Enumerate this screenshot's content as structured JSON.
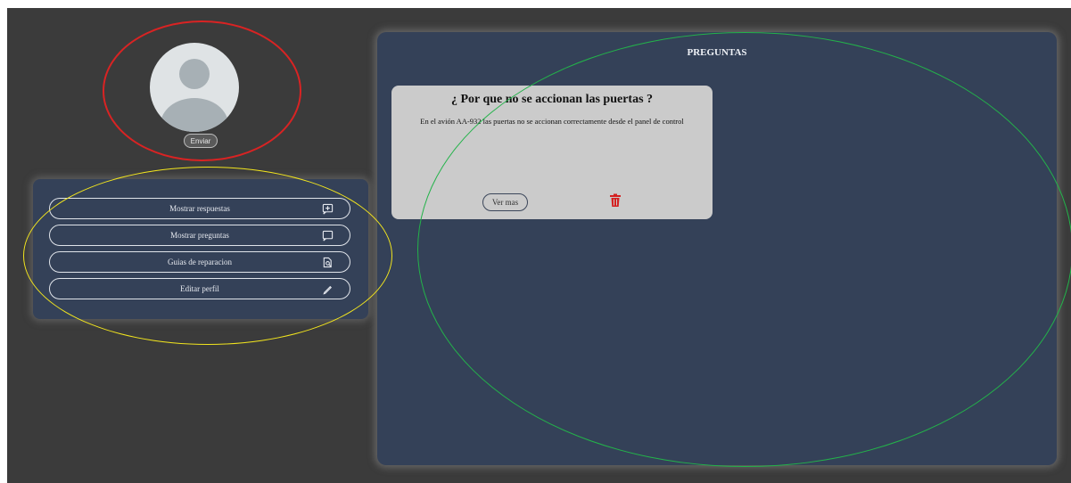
{
  "profile": {
    "avatar_icon": "user-avatar-icon",
    "send_label": "Enviar"
  },
  "menu": {
    "items": [
      {
        "label": "Mostrar respuestas",
        "icon": "add-comment-icon"
      },
      {
        "label": "Mostrar preguntas",
        "icon": "comment-icon"
      },
      {
        "label": "Guias de reparacion",
        "icon": "document-search-icon"
      },
      {
        "label": "Editar perfil",
        "icon": "pencil-icon"
      }
    ]
  },
  "questions": {
    "title": "PREGUNTAS",
    "cards": [
      {
        "title": "¿ Por que no se accionan las puertas ?",
        "description": "En el avión AA-932 las puertas no se accionan correctamente desde el panel de control",
        "more_label": "Ver mas",
        "delete_icon": "trash-icon"
      }
    ]
  },
  "annotations": {
    "colors": [
      "#d92323",
      "#f2e51e",
      "#23b34a"
    ]
  },
  "colors": {
    "background": "#3b3b3b",
    "panel": "#344158",
    "card": "#cbcbcb",
    "delete": "#d42020"
  }
}
